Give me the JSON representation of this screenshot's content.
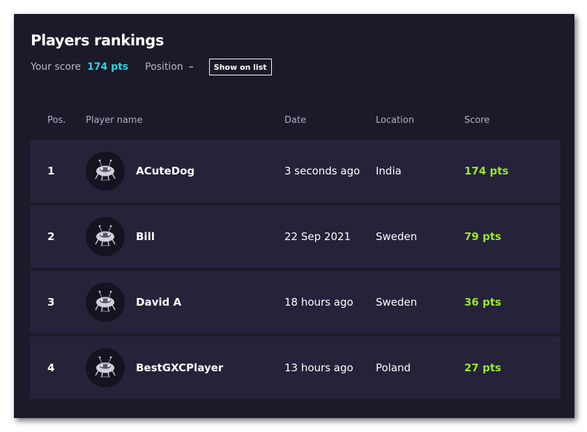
{
  "header": {
    "title": "Players rankings",
    "your_score_label": "Your score",
    "your_score_value": "174 pts",
    "position_label": "Position",
    "position_value": "–",
    "show_on_list_label": "Show on list"
  },
  "table": {
    "columns": {
      "pos": "Pos.",
      "player_name": "Player name",
      "date": "Date",
      "location": "Location",
      "score": "Score"
    },
    "rows": [
      {
        "pos": "1",
        "name": "ACuteDog",
        "date": "3 seconds ago",
        "location": "India",
        "score": "174 pts"
      },
      {
        "pos": "2",
        "name": "Bill",
        "date": "22 Sep 2021",
        "location": "Sweden",
        "score": "79 pts"
      },
      {
        "pos": "3",
        "name": "David A",
        "date": "18 hours ago",
        "location": "Sweden",
        "score": "36 pts"
      },
      {
        "pos": "4",
        "name": "BestGXCPlayer",
        "date": "13 hours ago",
        "location": "Poland",
        "score": "27 pts"
      }
    ]
  },
  "colors": {
    "panel_bg": "#1c1a28",
    "row_bg": "#25223a",
    "score_accent": "#28d6e6",
    "points_green": "#9ae62c"
  },
  "icons": {
    "avatar": "robot-bug-icon"
  }
}
